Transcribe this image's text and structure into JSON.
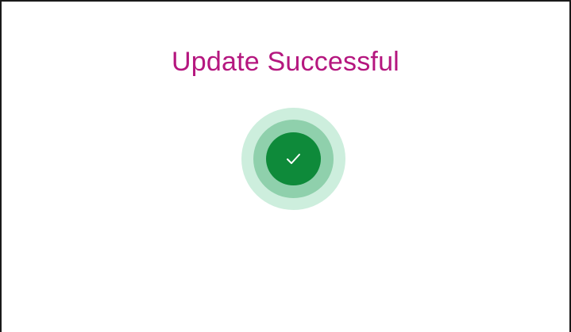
{
  "dialog": {
    "title": "Update Successful",
    "icon": "check-icon"
  },
  "colors": {
    "title": "#b5177f",
    "ring_outer": "#cdeedd",
    "ring_middle": "#8fd0ac",
    "ring_inner": "#0e8a3a",
    "check": "#ffffff",
    "border": "#1a1a1a"
  }
}
